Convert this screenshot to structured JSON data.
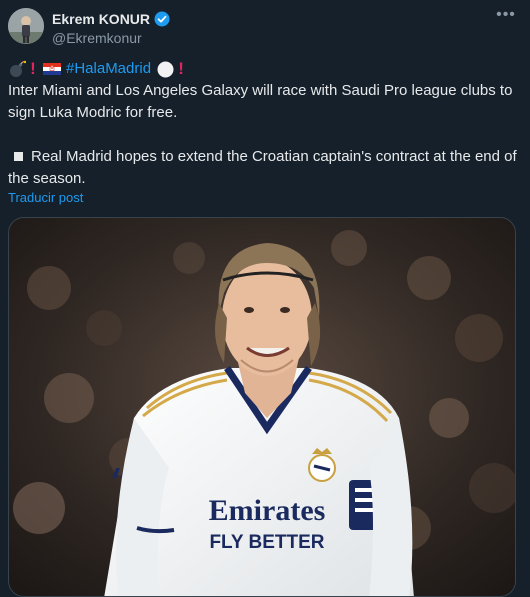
{
  "author": {
    "display_name": "Ekrem KONUR",
    "handle": "@Ekremkonur",
    "verified": true,
    "avatar_icon": "avatar-photo"
  },
  "tweet": {
    "hashtag": "#HalaMadrid",
    "emoji_sequence": [
      "bomb-icon",
      "exclamation-icon",
      "croatia-flag-icon",
      "hashtag",
      "white-circle-icon",
      "exclamation-icon"
    ],
    "paragraph_1": "Inter Miami and Los Angeles Galaxy will race with Saudi Pro league clubs to sign Luka Modric for free.",
    "paragraph_2": "Real Madrid hopes to extend the Croatian captain's contract at the end of the season.",
    "translate_label": "Traducir post"
  },
  "media": {
    "shirt_sponsor_line1": "Emirates",
    "shirt_sponsor_line2": "FLY BETTER"
  },
  "colors": {
    "background": "#15202b",
    "accent": "#1d9bf0",
    "text": "#e7e9ea",
    "muted": "#8b98a5"
  }
}
